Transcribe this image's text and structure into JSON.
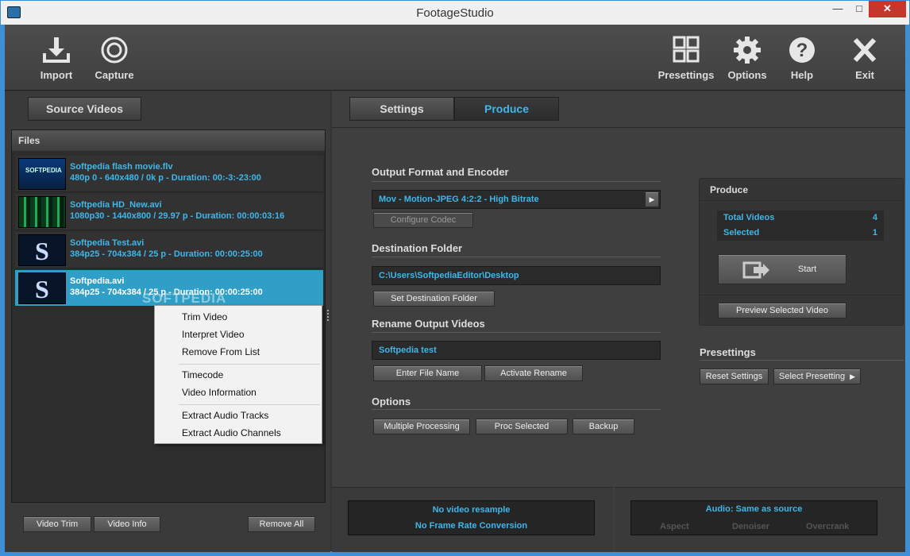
{
  "window": {
    "title": "FootageStudio",
    "minimize": "—",
    "maximize": "□",
    "close": "✕"
  },
  "toolbar": {
    "import": "Import",
    "capture": "Capture",
    "presettings": "Presettings",
    "options": "Options",
    "help": "Help",
    "exit": "Exit"
  },
  "left": {
    "source_tab": "Source Videos",
    "files_header": "Files",
    "files": [
      {
        "name": "Softpedia flash movie.flv",
        "meta": "480p 0 - 640x480 / 0k p - Duration:  00:-3:-23:00",
        "thumb": "SOFTPEDIA"
      },
      {
        "name": "Softpedia HD_New.avi",
        "meta": "1080p30 - 1440x800 / 29.97 p  - Duration:  00:00:03:16",
        "thumb": ""
      },
      {
        "name": "Softpedia Test.avi",
        "meta": "384p25 - 704x384 / 25 p - Duration:  00:00:25:00",
        "thumb": "S"
      },
      {
        "name": "Softpedia.avi",
        "meta": "384p25 - 704x384 / 25 p - Duration:  00:00:25:00",
        "thumb": "S"
      }
    ],
    "watermark": "SOFTPEDIA",
    "buttons": {
      "video_trim": "Video Trim",
      "video_info": "Video Info",
      "remove_all": "Remove All"
    }
  },
  "context_menu": {
    "items": [
      "Trim Video",
      "Interpret Video",
      "Remove From List",
      "Timecode",
      "Video Information",
      "Extract Audio Tracks",
      "Extract Audio Channels"
    ]
  },
  "right": {
    "tabs": {
      "settings": "Settings",
      "produce": "Produce"
    },
    "output_format": {
      "heading": "Output Format and Encoder",
      "value": "Mov - Motion-JPEG 4:2:2 - High Bitrate",
      "configure": "Configure Codec"
    },
    "destination": {
      "heading": "Destination Folder",
      "value": "C:\\Users\\SoftpediaEditor\\Desktop",
      "set_button": "Set Destination Folder"
    },
    "rename": {
      "heading": "Rename Output Videos",
      "value": "Softpedia test",
      "enter_button": "Enter File Name",
      "activate_button": "Activate Rename"
    },
    "options": {
      "heading": "Options",
      "multiple": "Multiple Processing",
      "proc_selected": "Proc Selected",
      "backup": "Backup"
    },
    "produce": {
      "heading": "Produce",
      "total_label": "Total Videos",
      "total_value": "4",
      "selected_label": "Selected",
      "selected_value": "1",
      "start": "Start",
      "preview": "Preview Selected Video"
    },
    "presettings": {
      "heading": "Presettings",
      "reset": "Reset Settings",
      "select": "Select Presetting"
    },
    "status": {
      "resample": "No video resample",
      "framerate": "No Frame Rate Conversion",
      "audio": "Audio:  Same as source",
      "aspect": "Aspect",
      "denoiser": "Denoiser",
      "overcrank": "Overcrank"
    }
  },
  "colors": {
    "accent": "#3fb7ea",
    "selection": "#2f9fc7",
    "frame": "#3e8fd6"
  }
}
